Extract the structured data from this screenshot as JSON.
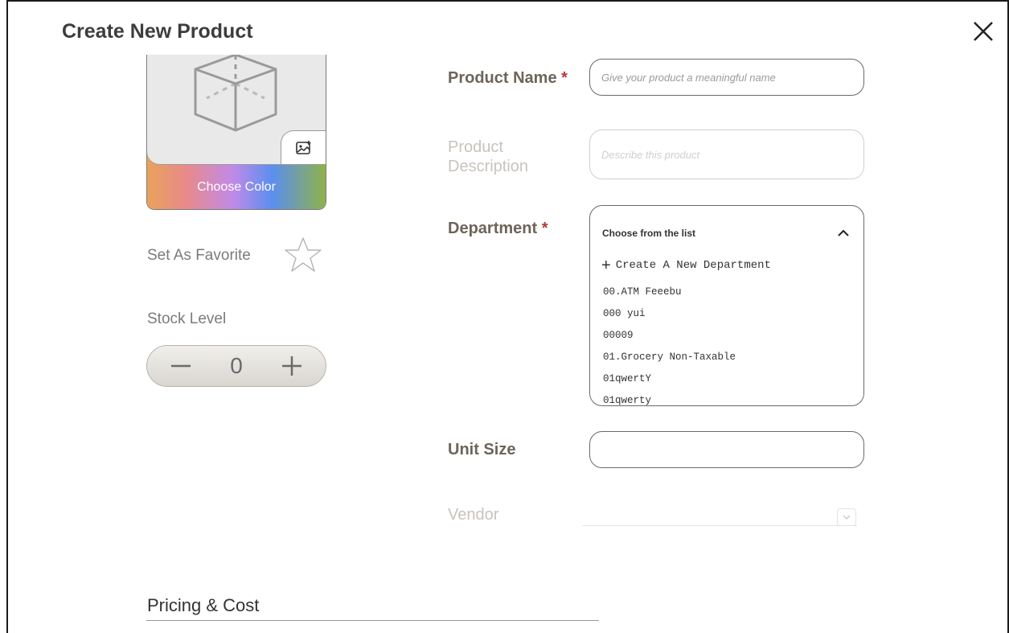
{
  "dialog": {
    "title": "Create New Product",
    "close_icon": "close-icon"
  },
  "image_card": {
    "placeholder_icon": "cube-icon",
    "upload_icon": "image-upload-icon",
    "choose_color_label": "Choose Color",
    "gradient_colors": [
      "#e9a25a",
      "#e88a8a",
      "#c08ae8",
      "#5b8ff0",
      "#8fb24a"
    ]
  },
  "favorite": {
    "label": "Set As Favorite",
    "icon": "star-outline-icon",
    "selected": false
  },
  "stock": {
    "label": "Stock Level",
    "value": "0",
    "decrement_icon": "minus-icon",
    "increment_icon": "plus-icon"
  },
  "form": {
    "product_name": {
      "label": "Product Name",
      "required_mark": "*",
      "placeholder": "Give your product a meaningful name"
    },
    "product_description": {
      "label_line1": "Product",
      "label_line2": "Description",
      "placeholder": "Describe this product"
    },
    "department": {
      "label": "Department",
      "required_mark": "*",
      "dropdown_header": "Choose from the list",
      "create_label": "Create A New Department",
      "options": [
        "00.ATM Feeebu",
        "000 yui",
        "00009",
        "01.Grocery Non-Taxable",
        "01qwertY",
        "01qwerty"
      ]
    },
    "unit_size": {
      "label": "Unit Size",
      "value": ""
    },
    "vendor": {
      "label": "Vendor"
    }
  },
  "section": {
    "title": "Pricing & Cost"
  },
  "colors": {
    "required": "#b33939",
    "label": "#6e6459",
    "muted": "#c8c3bc"
  }
}
